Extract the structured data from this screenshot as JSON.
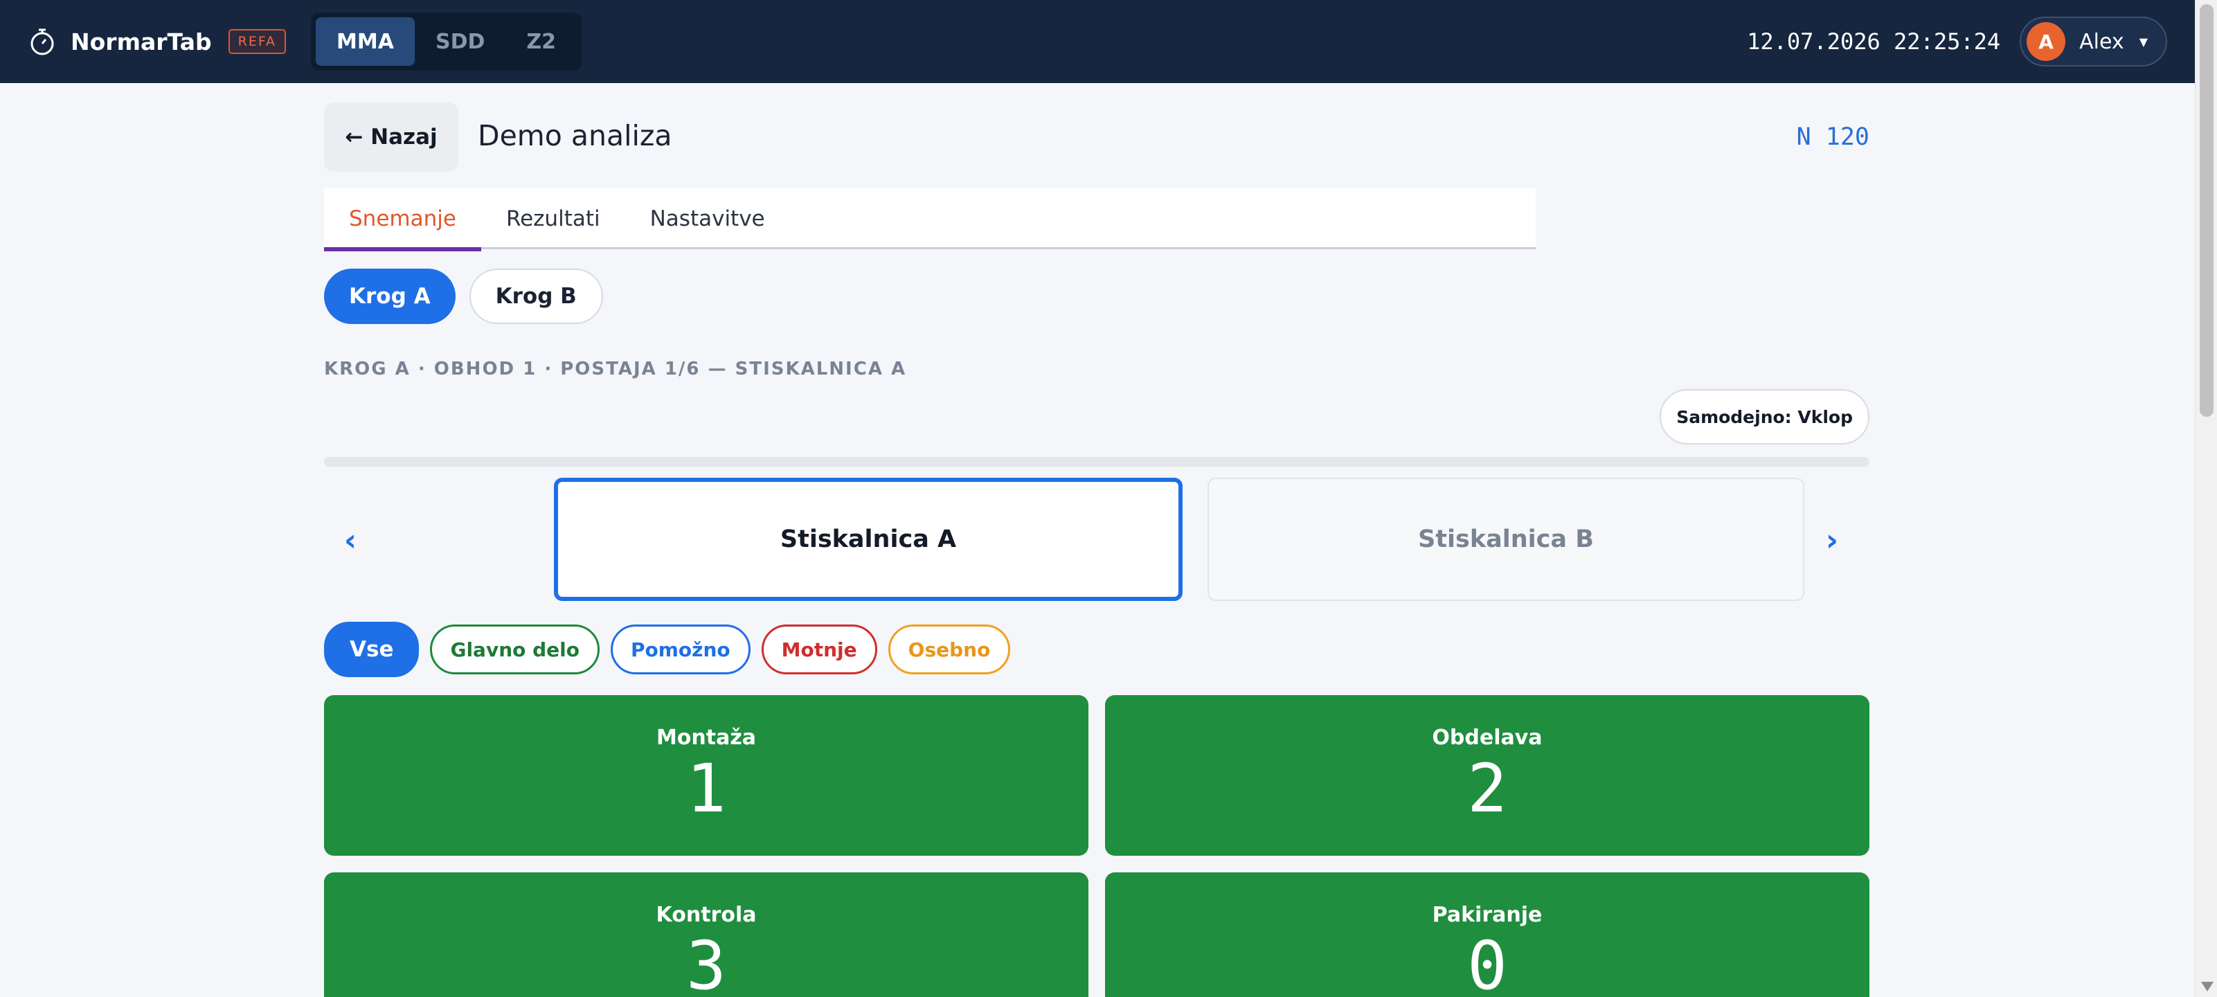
{
  "topbar": {
    "app_name": "NormarTab",
    "badge": "REFA",
    "modes": [
      "MMA",
      "SDD",
      "Z2"
    ],
    "active_mode": "MMA",
    "datetime": "12.07.2026 22:25:24",
    "user": {
      "initial": "A",
      "name": "Alex"
    }
  },
  "header": {
    "back_label": "← Nazaj",
    "title": "Demo analiza",
    "n_count": "N 120"
  },
  "tabs": [
    "Snemanje",
    "Rezultati",
    "Nastavitve"
  ],
  "active_tab": "Snemanje",
  "rounds": [
    "Krog A",
    "Krog B"
  ],
  "active_round": "Krog A",
  "breadcrumb": "KROG A · OBHOD 1 · POSTAJA 1/6 — STISKALNICA A",
  "auto_label": "Samodejno: Vklop",
  "stations": {
    "prev_icon": "‹",
    "next_icon": "›",
    "active": "Stiskalnica A",
    "next": "Stiskalnica B"
  },
  "filters": [
    "Vse",
    "Glavno delo",
    "Pomožno",
    "Motnje",
    "Osebno"
  ],
  "counters": [
    {
      "label": "Montaža",
      "value": "1"
    },
    {
      "label": "Obdelava",
      "value": "2"
    },
    {
      "label": "Kontrola",
      "value": "3"
    },
    {
      "label": "Pakiranje",
      "value": "0"
    }
  ],
  "colors": {
    "topbar": "#16263f",
    "accent": "#1f6fe6",
    "counter_green": "#1f8e3f",
    "active_tab_text": "#e1572a",
    "tab_underline": "#6a2fa4"
  }
}
